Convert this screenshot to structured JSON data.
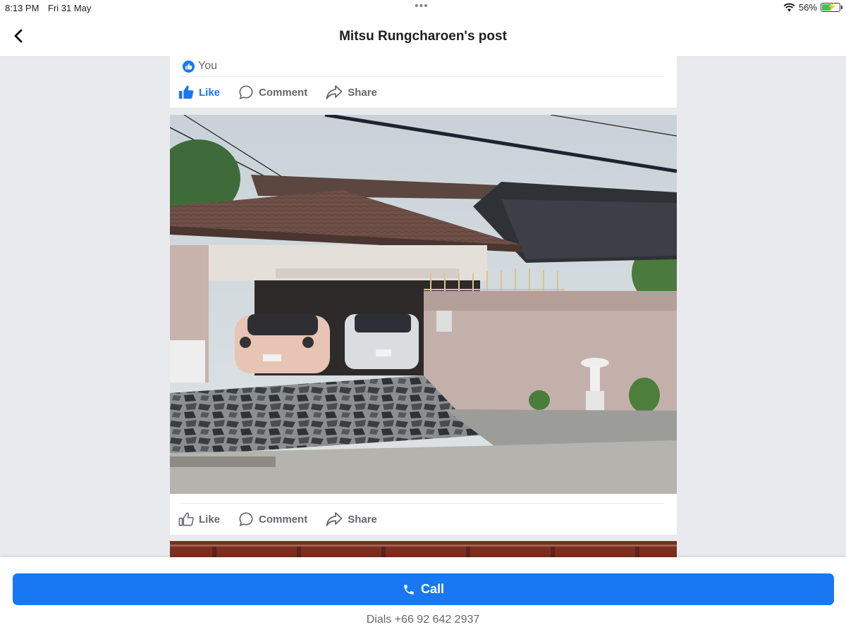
{
  "status_bar": {
    "time": "8:13 PM",
    "date": "Fri 31 May",
    "dots": "•••",
    "battery": "56%",
    "battery_level": 0.56
  },
  "nav": {
    "back_icon": "chevron-left-icon",
    "title": "Mitsu Rungcharoen's post"
  },
  "post": {
    "reactions": {
      "icon": "like-badge-icon",
      "label": "You"
    },
    "actions_top": {
      "like": "Like",
      "comment": "Comment",
      "share": "Share",
      "like_active": true
    },
    "photo": {
      "icon": "photo-image"
    },
    "actions_bottom": {
      "like": "Like",
      "comment": "Comment",
      "share": "Share",
      "like_active": false
    }
  },
  "call_panel": {
    "button_label": "Call",
    "button_icon": "phone-icon",
    "dials_text": "Dials +66 92 642 2937"
  },
  "colors": {
    "accent": "#1877f2",
    "background": "#e9eaee",
    "muted_text": "#65676b"
  }
}
